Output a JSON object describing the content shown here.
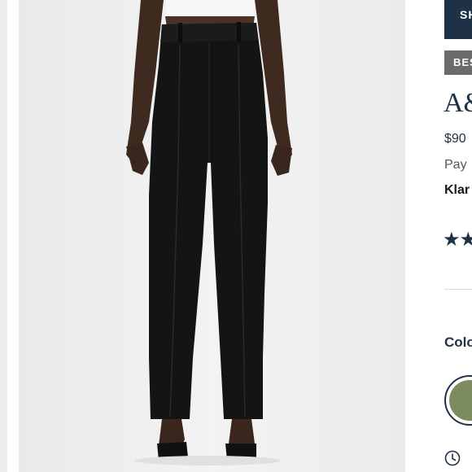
{
  "panel": {
    "shop_button_label": "SH",
    "badge_label": "BES",
    "product_title": "A&",
    "price": "$90",
    "pay_text": "Pay",
    "klarna_label": "Klar",
    "rating_stars": "★★",
    "color_label": "Colo"
  },
  "colors": {
    "accent_navy": "#1f3245",
    "badge_gray": "#6b6b6b",
    "swatch_olive": "#7d8c5e",
    "image_background": "#efefef"
  },
  "icons": {
    "clock": "clock-icon"
  }
}
